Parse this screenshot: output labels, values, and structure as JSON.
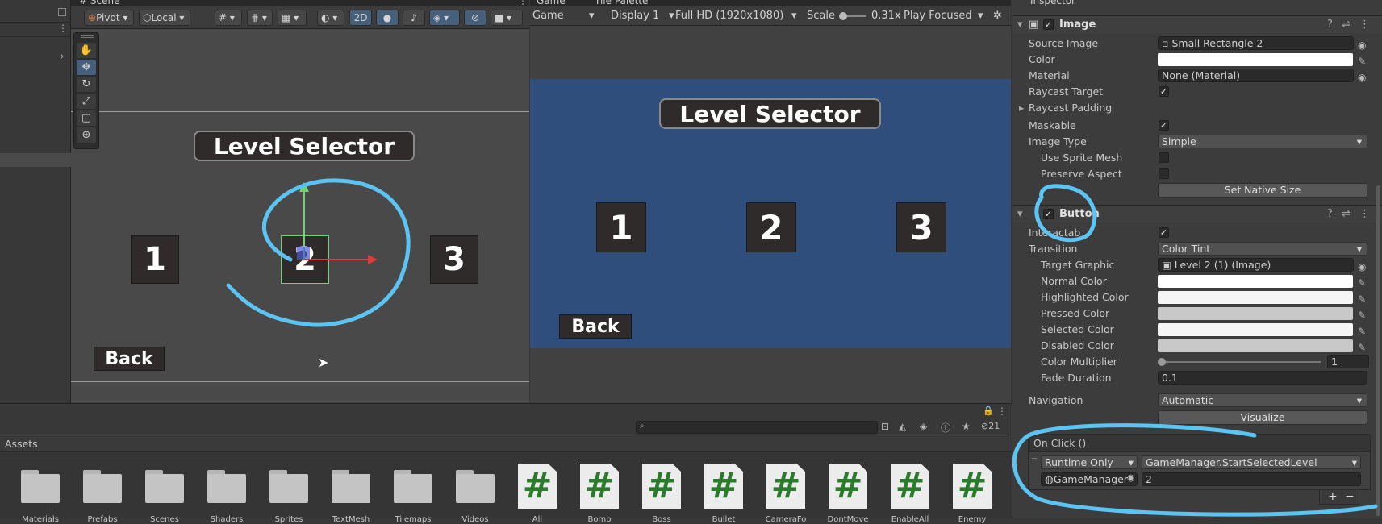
{
  "scene": {
    "tab": "# Scene",
    "toolbar": {
      "pivot": "Pivot",
      "local": "Local",
      "mode_2d": "2D"
    },
    "title": "Level Selector",
    "levels": [
      "1",
      "2",
      "3"
    ],
    "back": "Back"
  },
  "game": {
    "tabs": [
      "Game",
      "Tile Palette"
    ],
    "toolbar": {
      "view": "Game",
      "display": "Display 1",
      "resolution": "Full HD (1920x1080)",
      "scale_label": "Scale",
      "scale_value": "0.31x",
      "play_mode": "Play Focused"
    },
    "title": "Level Selector",
    "levels": [
      "1",
      "2",
      "3"
    ],
    "back": "Back"
  },
  "inspector": {
    "tab": "Inspector",
    "image": {
      "header": "Image",
      "source_image_label": "Source Image",
      "source_image_value": "Small Rectangle 2",
      "color_label": "Color",
      "color_value": "#ffffff",
      "material_label": "Material",
      "material_value": "None (Material)",
      "raycast_target_label": "Raycast Target",
      "raycast_padding_label": "Raycast Padding",
      "maskable_label": "Maskable",
      "image_type_label": "Image Type",
      "image_type_value": "Simple",
      "use_sprite_mesh_label": "Use Sprite Mesh",
      "preserve_aspect_label": "Preserve Aspect",
      "set_native_size": "Set Native Size"
    },
    "button": {
      "header": "Button",
      "interactable_label": "Interactab",
      "transition_label": "Transition",
      "transition_value": "Color Tint",
      "target_graphic_label": "Target Graphic",
      "target_graphic_value": "Level 2 (1) (Image)",
      "normal_color_label": "Normal Color",
      "highlighted_color_label": "Highlighted Color",
      "pressed_color_label": "Pressed Color",
      "selected_color_label": "Selected Color",
      "disabled_color_label": "Disabled Color",
      "color_multiplier_label": "Color Multiplier",
      "color_multiplier_value": "1",
      "fade_duration_label": "Fade Duration",
      "fade_duration_value": "0.1",
      "navigation_label": "Navigation",
      "navigation_value": "Automatic",
      "visualize": "Visualize",
      "on_click_label": "On Click ()",
      "runtime_value": "Runtime Only",
      "function_value": "GameManager.StartSelectedLevel",
      "object_value": "GameManager",
      "argument_value": "2",
      "add": "+",
      "remove": "−"
    }
  },
  "project": {
    "assets_header": "Assets",
    "hidden_count": "21",
    "folders": [
      "Materials",
      "Prefabs",
      "Scenes",
      "Shaders",
      "Sprites",
      "TextMesh",
      "Tilemaps",
      "Videos"
    ],
    "scripts": [
      "All",
      "Bomb",
      "Boss",
      "Bullet",
      "CameraFo",
      "DontMove",
      "EnableAll",
      "Enemy"
    ]
  }
}
